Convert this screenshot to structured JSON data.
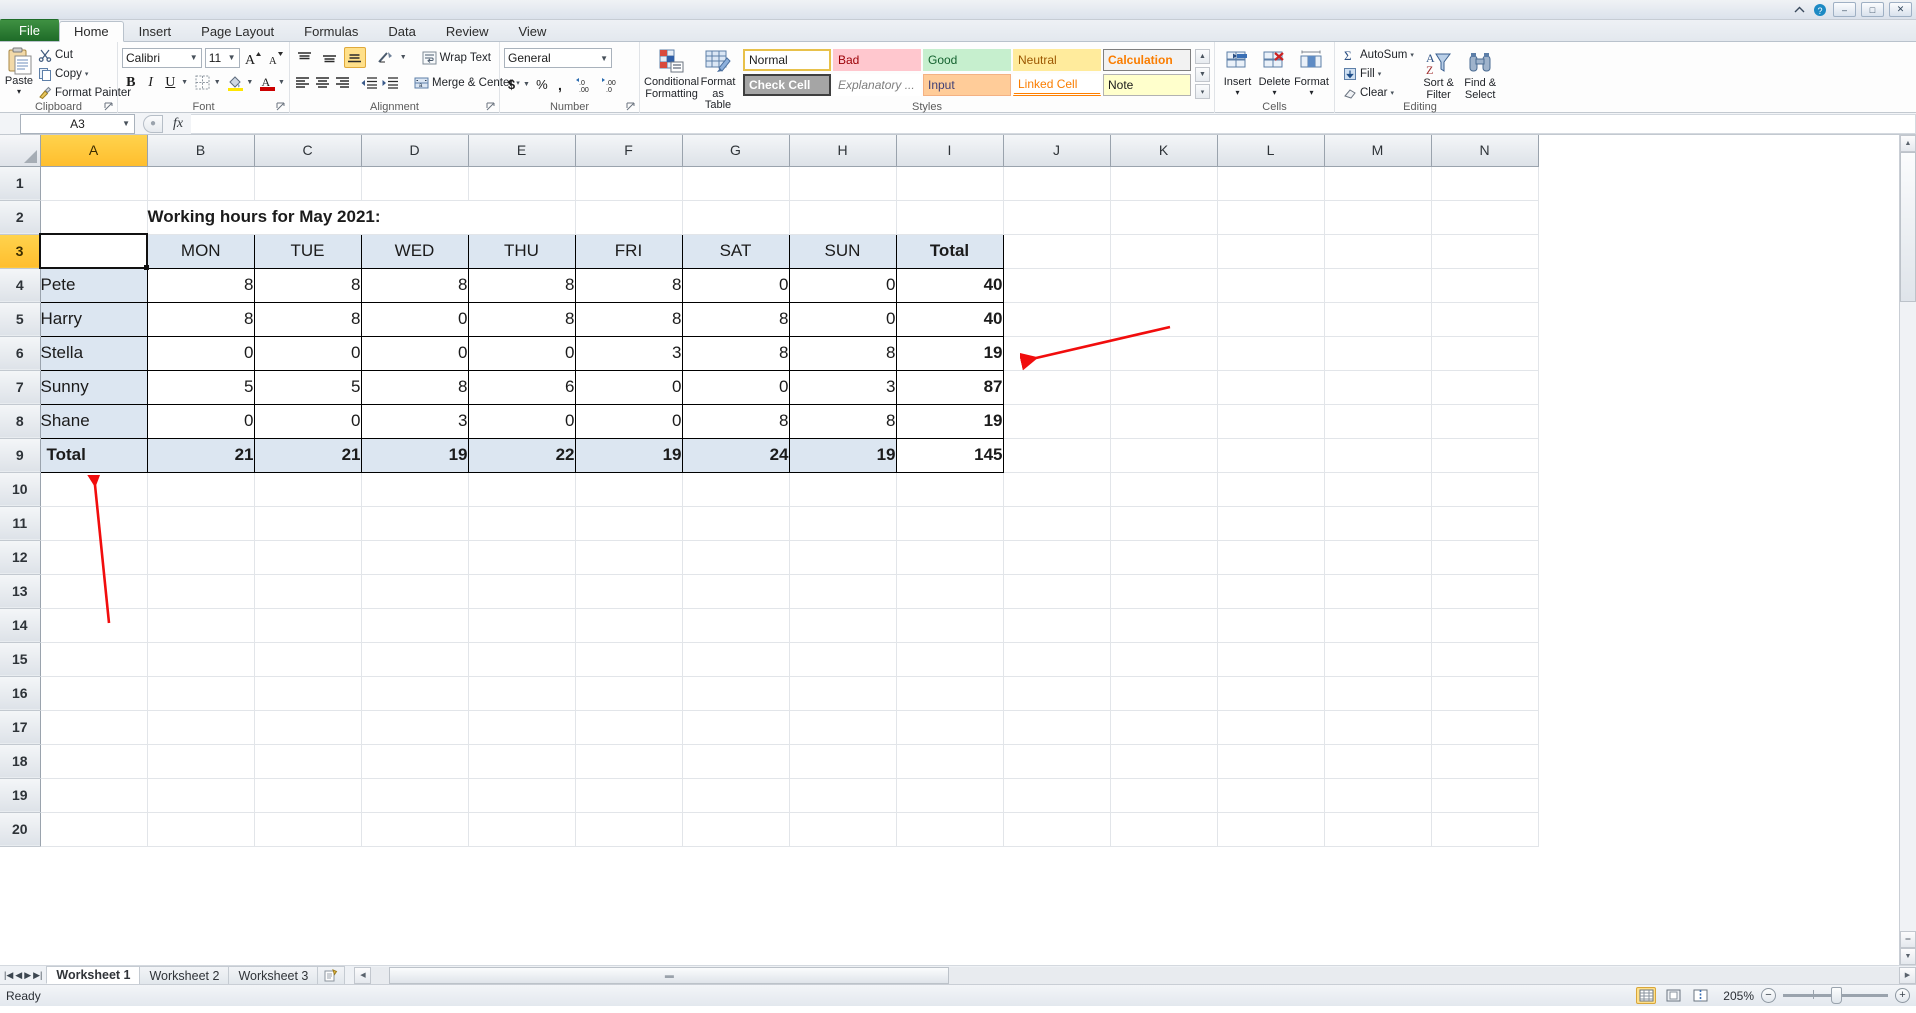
{
  "titlebar": {
    "icons": [
      "minimize-ribbon-icon",
      "help-icon"
    ],
    "window_buttons": [
      "–",
      "□",
      "✕"
    ]
  },
  "ribbon": {
    "tabs": [
      {
        "label": "File",
        "active": false
      },
      {
        "label": "Home",
        "active": true
      },
      {
        "label": "Insert",
        "active": false
      },
      {
        "label": "Page Layout",
        "active": false
      },
      {
        "label": "Formulas",
        "active": false
      },
      {
        "label": "Data",
        "active": false
      },
      {
        "label": "Review",
        "active": false
      },
      {
        "label": "View",
        "active": false
      }
    ],
    "groups": {
      "clipboard": {
        "label": "Clipboard",
        "paste": "Paste",
        "cut": "Cut",
        "copy": "Copy",
        "format_painter": "Format Painter"
      },
      "font": {
        "label": "Font",
        "font_name": "Calibri",
        "font_size": "11",
        "bold": "B",
        "italic": "I",
        "underline": "U"
      },
      "alignment": {
        "label": "Alignment",
        "wrap_text": "Wrap Text",
        "merge_center": "Merge & Center"
      },
      "number": {
        "label": "Number",
        "format": "General",
        "currency": "$",
        "percent": "%",
        "comma": ","
      },
      "styles": {
        "label": "Styles",
        "conditional_formatting": "Conditional\nFormatting",
        "conditional_formatting_l1": "Conditional",
        "conditional_formatting_l2": "Formatting",
        "format_as_table_l1": "Format",
        "format_as_table_l2": "as Table",
        "cell_styles": [
          {
            "label": "Normal",
            "style": "normal"
          },
          {
            "label": "Bad",
            "style": "bad"
          },
          {
            "label": "Good",
            "style": "good"
          },
          {
            "label": "Neutral",
            "style": "neutral"
          },
          {
            "label": "Calculation",
            "style": "calculation"
          },
          {
            "label": "Check Cell",
            "style": "check-cell"
          },
          {
            "label": "Explanatory ...",
            "style": "explanatory"
          },
          {
            "label": "Input",
            "style": "input"
          },
          {
            "label": "Linked Cell",
            "style": "linked-cell"
          },
          {
            "label": "Note",
            "style": "note"
          }
        ]
      },
      "cells": {
        "label": "Cells",
        "insert": "Insert",
        "delete": "Delete",
        "format": "Format"
      },
      "editing": {
        "label": "Editing",
        "autosum": "AutoSum",
        "fill": "Fill",
        "clear": "Clear",
        "sort_filter_l1": "Sort &",
        "sort_filter_l2": "Filter",
        "find_select_l1": "Find &",
        "find_select_l2": "Select"
      }
    }
  },
  "formula_bar": {
    "name_box": "A3",
    "formula_value": "",
    "fx_label": "fx"
  },
  "grid": {
    "column_headers": [
      "A",
      "B",
      "C",
      "D",
      "E",
      "F",
      "G",
      "H",
      "I",
      "J",
      "K",
      "L",
      "M",
      "N"
    ],
    "highlighted_column": "A",
    "row_headers": [
      "1",
      "2",
      "3",
      "4",
      "5",
      "6",
      "7",
      "8",
      "9",
      "10",
      "11",
      "12",
      "13",
      "14",
      "15",
      "16",
      "17",
      "18",
      "19",
      "20"
    ],
    "highlighted_row": "3",
    "selected_cell": "A3",
    "title_text": "Working hours for May 2021:"
  },
  "chart_data": {
    "type": "table",
    "title": "Working hours for May 2021:",
    "columns": [
      "",
      "MON",
      "TUE",
      "WED",
      "THU",
      "FRI",
      "SAT",
      "SUN",
      "Total"
    ],
    "rows": [
      {
        "name": "Pete",
        "values": [
          8,
          8,
          8,
          8,
          8,
          0,
          0
        ],
        "total": 40
      },
      {
        "name": "Harry",
        "values": [
          8,
          8,
          0,
          8,
          8,
          8,
          0
        ],
        "total": 40
      },
      {
        "name": "Stella",
        "values": [
          0,
          0,
          0,
          0,
          3,
          8,
          8
        ],
        "total": 19
      },
      {
        "name": "Sunny",
        "values": [
          5,
          5,
          8,
          6,
          0,
          0,
          3
        ],
        "total": 87
      },
      {
        "name": "Shane",
        "values": [
          0,
          0,
          3,
          0,
          0,
          8,
          8
        ],
        "total": 19
      }
    ],
    "totals_row": {
      "name": "Total",
      "values": [
        21,
        21,
        19,
        22,
        19,
        24,
        19
      ],
      "total": 145
    }
  },
  "annotations": [
    {
      "name": "arrow-to-column-j",
      "color": "#ff0000",
      "from": [
        1168,
        193
      ],
      "to": [
        1032,
        223
      ]
    },
    {
      "name": "arrow-to-cell-a10",
      "color": "#ff0000",
      "from": [
        109,
        620
      ],
      "to": [
        95,
        479
      ]
    }
  ],
  "sheet_tabs": {
    "tabs": [
      {
        "label": "Worksheet 1",
        "active": true
      },
      {
        "label": "Worksheet 2",
        "active": false
      },
      {
        "label": "Worksheet 3",
        "active": false
      }
    ],
    "insert_sheet": "insert-worksheet-icon"
  },
  "status_bar": {
    "status": "Ready",
    "zoom_level": "205%",
    "views": [
      "normal-view",
      "page-layout-view",
      "page-break-preview"
    ],
    "zoom_out": "−",
    "zoom_in": "+"
  }
}
